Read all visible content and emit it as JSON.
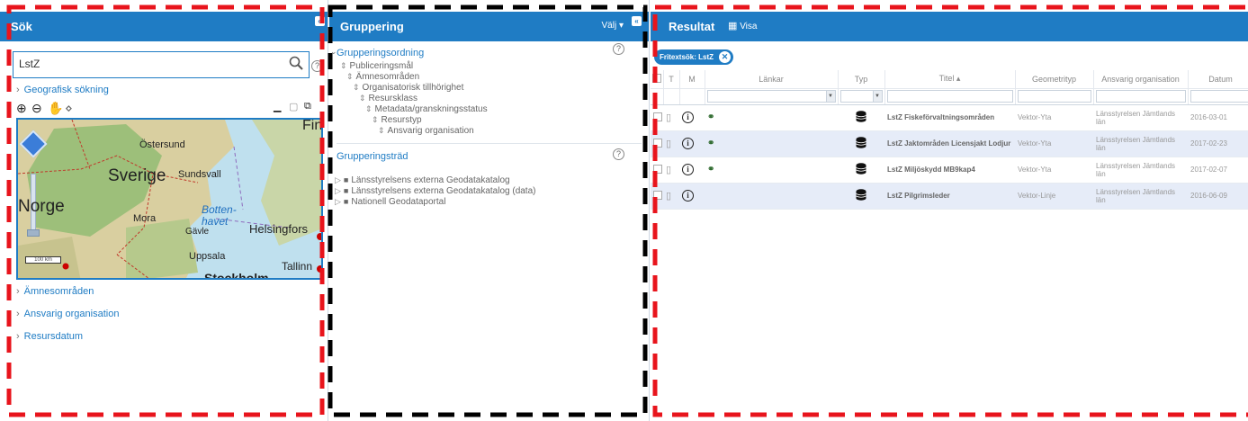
{
  "left_panel": {
    "title": "Sök",
    "search": {
      "value": "LstZ",
      "placeholder": ""
    },
    "geo_search_label": "Geografisk sökning",
    "map_labels": [
      "Östersund",
      "Sverige",
      "Sundsvall",
      "Norge",
      "Mora",
      "Botten-",
      "havet",
      "Gävle",
      "Helsingfors",
      "Uppsala",
      "Tallinn",
      "Stockholm",
      "Fin"
    ],
    "scale_label": "100 km",
    "sections": [
      "Ämnesområden",
      "Ansvarig organisation",
      "Resursdatum"
    ],
    "help": "?"
  },
  "mid_panel": {
    "title": "Gruppering",
    "valj_label": "Välj",
    "order_title": "Grupperingsordning",
    "order_items": [
      "Publiceringsmål",
      "Ämnesområden",
      "Organisatorisk tillhörighet",
      "Resursklass",
      "Metadata/granskningsstatus",
      "Resurstyp",
      "Ansvarig organisation"
    ],
    "tree_title": "Grupperingsträd",
    "tree_items": [
      "Länsstyrelsens externa Geodatakatalog",
      "Länsstyrelsens externa Geodatakatalog (data)",
      "Nationell Geodataportal"
    ],
    "help": "?"
  },
  "right_panel": {
    "title": "Resultat",
    "visa_label": "Visa",
    "filter_tag": "Fritextsök: LstZ",
    "columns": {
      "t": "T",
      "m": "M",
      "links": "Länkar",
      "type": "Typ",
      "title": "Titel ▴",
      "geom": "Geometrityp",
      "org": "Ansvarig organisation",
      "date": "Datum"
    },
    "rows": [
      {
        "title": "LstZ Fiskeförvaltningsområden",
        "geom": "Vektor-Yta",
        "org": "Länsstyrelsen Jämtlands län",
        "date": "2016-03-01",
        "has_link": true
      },
      {
        "title": "LstZ Jaktområden Licensjakt Lodjur",
        "geom": "Vektor-Yta",
        "org": "Länsstyrelsen Jämtlands län",
        "date": "2017-02-23",
        "has_link": true
      },
      {
        "title": "LstZ Miljöskydd MB9kap4",
        "geom": "Vektor-Yta",
        "org": "Länsstyrelsen Jämtlands län",
        "date": "2017-02-07",
        "has_link": true
      },
      {
        "title": "LstZ Pilgrimsleder",
        "geom": "Vektor-Linje",
        "org": "Länsstyrelsen Jämtlands län",
        "date": "2016-06-09",
        "has_link": false
      }
    ]
  },
  "colors": {
    "accent": "#1f7cc4",
    "frame_red": "#e8141c",
    "frame_black": "#000000",
    "row_alt": "#e6ecf8"
  }
}
